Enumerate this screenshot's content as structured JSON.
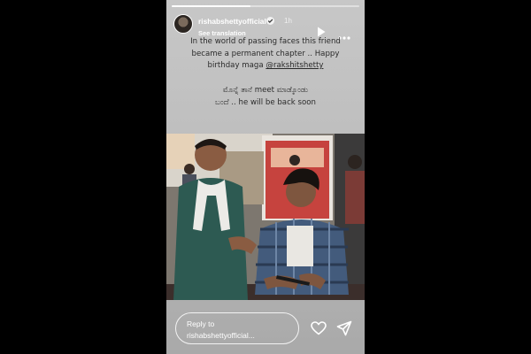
{
  "story": {
    "progress": 0.42,
    "username": "rishabshettyofficial",
    "time": "1h",
    "see_translation": "See translation",
    "caption_lines": [
      "In the world of passing faces this friend",
      "became a permanent chapter .. Happy",
      "birthday maga @rakshitshetty",
      "ಮೊನ್ನೆ ತಾನೆ meet ಮಾಡ್ಕೊಂಡು",
      "ಬಂದೆ .. he will be back soon"
    ],
    "mention": "@rakshitshetty",
    "reply_line1": "Reply to",
    "reply_line2": "rishabshettyofficial..."
  },
  "icons": {
    "verified": "verified-badge-icon",
    "play": "play-icon",
    "more": "more-options-icon",
    "heart": "heart-icon",
    "send": "send-icon"
  },
  "colors": {
    "story_bg_top": "#c7c7c7",
    "story_bg_bottom": "#a9a9a9",
    "caption_text": "#2a2a2a",
    "page_bg": "#000000"
  }
}
